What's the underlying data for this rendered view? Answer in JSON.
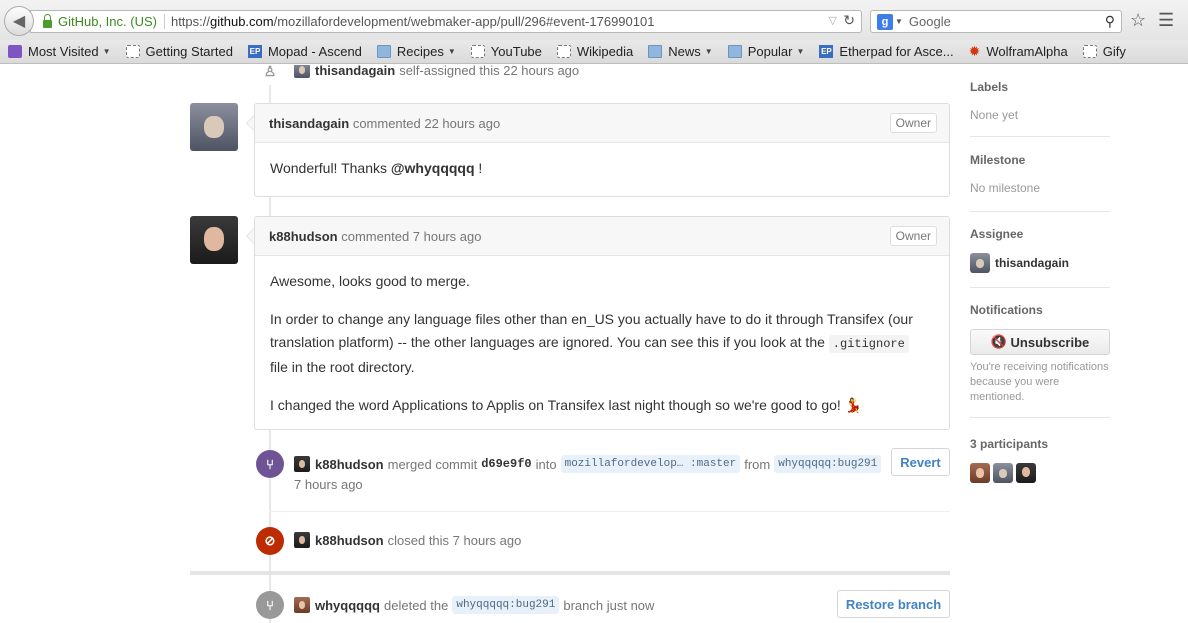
{
  "browser": {
    "site_identity": "GitHub, Inc. (US)",
    "url_prefix": "https://",
    "url_domain": "github.com",
    "url_path": "/mozillafordevelopment/webmaker-app/pull/296#event-176990101",
    "search_placeholder": "Google"
  },
  "bookmarks": [
    {
      "label": "Most Visited",
      "icon": "most-visited-icon",
      "dropdown": true
    },
    {
      "label": "Getting Started",
      "icon": "page-icon",
      "dropdown": false
    },
    {
      "label": "Mopad - Ascend",
      "icon": "etherpad-icon",
      "dropdown": false
    },
    {
      "label": "Recipes",
      "icon": "folder-icon",
      "dropdown": true
    },
    {
      "label": "YouTube",
      "icon": "page-icon",
      "dropdown": false
    },
    {
      "label": "Wikipedia",
      "icon": "page-icon",
      "dropdown": false
    },
    {
      "label": "News",
      "icon": "folder-icon",
      "dropdown": true
    },
    {
      "label": "Popular",
      "icon": "folder-icon",
      "dropdown": true
    },
    {
      "label": "Etherpad for Asce...",
      "icon": "etherpad-icon",
      "dropdown": false
    },
    {
      "label": "WolframAlpha",
      "icon": "wolfram-icon",
      "dropdown": false
    },
    {
      "label": "Gify",
      "icon": "page-icon",
      "dropdown": false
    }
  ],
  "timeline": {
    "assign_event": {
      "user": "thisandagain",
      "text": "self-assigned this 22 hours ago"
    },
    "comment1": {
      "author": "thisandagain",
      "meta": "commented 22 hours ago",
      "badge": "Owner",
      "body_prefix": "Wonderful! Thanks",
      "mention": "@whyqqqqq",
      "body_suffix": "!"
    },
    "comment2": {
      "author": "k88hudson",
      "meta": "commented 7 hours ago",
      "badge": "Owner",
      "p1": "Awesome, looks good to merge.",
      "p2_a": "In order to change any language files other than en_US you actually have to do it through Transifex (our translation platform) -- the other languages are ignored. You can see this if you look at the",
      "p2_code": ".gitignore",
      "p2_b": "file in the root directory.",
      "p3": "I changed the word Applications to Applis on Transifex last night though so we're good to go!",
      "p3_emoji": "💃"
    },
    "merge_event": {
      "user": "k88hudson",
      "verb": "merged commit",
      "sha": "d69e9f0",
      "into": "into",
      "target_branch": "mozillafordevelop… :master",
      "from": "from",
      "source_branch": "whyqqqqq:bug291",
      "time": "7 hours ago",
      "button": "Revert"
    },
    "closed_event": {
      "user": "k88hudson",
      "text": "closed this 7 hours ago"
    },
    "deleted_event": {
      "user": "whyqqqqq",
      "verb": "deleted the",
      "branch": "whyqqqqq:bug291",
      "suffix": "branch just now",
      "button": "Restore branch"
    }
  },
  "sidebar": {
    "labels_title": "Labels",
    "labels_value": "None yet",
    "milestone_title": "Milestone",
    "milestone_value": "No milestone",
    "assignee_title": "Assignee",
    "assignee_name": "thisandagain",
    "notifications_title": "Notifications",
    "unsubscribe_label": "Unsubscribe",
    "notifications_text": "You're receiving notifications because you were mentioned.",
    "participants_title": "3 participants"
  }
}
